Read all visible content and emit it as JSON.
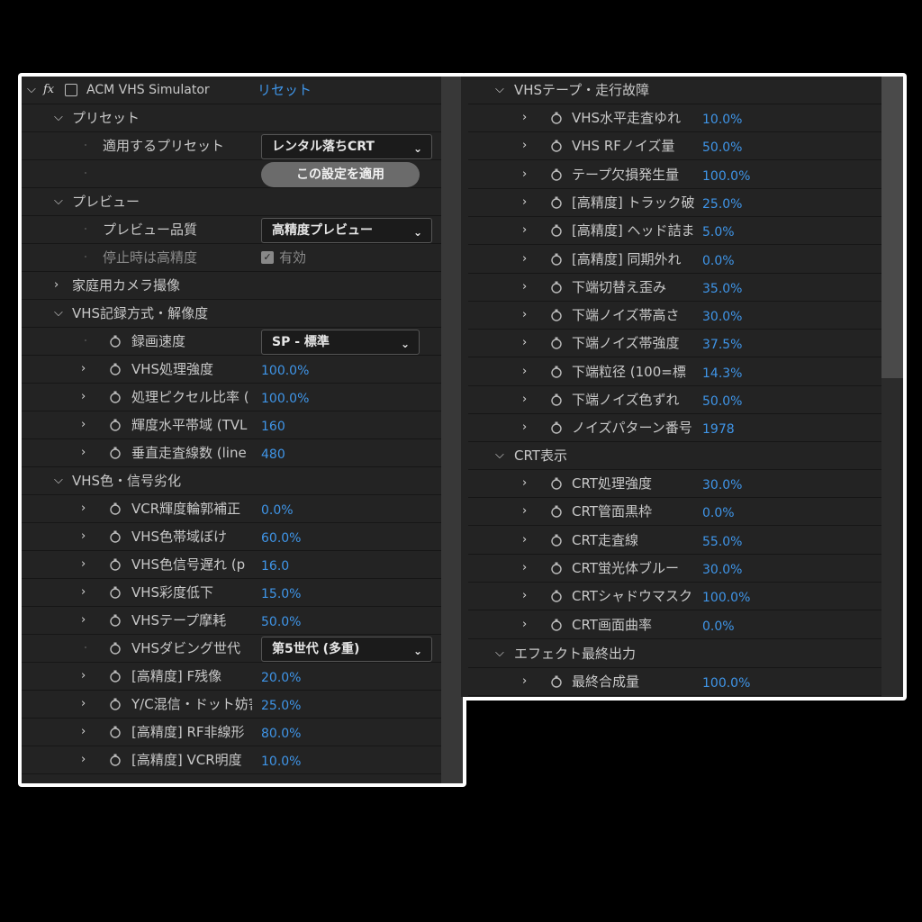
{
  "effect": {
    "title": "ACM VHS Simulator",
    "reset_label": "リセット",
    "fx_label": "fx"
  },
  "left": {
    "preset_group": "プリセット",
    "preset_label": "適用するプリセット",
    "preset_value": "レンタル落ちCRT",
    "apply_label": "この設定を適用",
    "preview_group": "プレビュー",
    "preview_quality_label": "プレビュー品質",
    "preview_quality_value": "高精度プレビュー",
    "still_hq_label": "停止時は高精度",
    "still_hq_checkbox": "有効",
    "home_camera_group": "家庭用カメラ撮像",
    "rec_group": "VHS記録方式・解像度",
    "rec_speed_label": "録画速度",
    "rec_speed_value": "SP - 標準",
    "rec_params": [
      {
        "label": "VHS処理強度",
        "value": "100.0%"
      },
      {
        "label": "処理ピクセル比率 (",
        "value": "100.0%"
      },
      {
        "label": "輝度水平帯域 (TVL",
        "value": "160"
      },
      {
        "label": "垂直走査線数 (line",
        "value": "480"
      }
    ],
    "color_group": "VHS色・信号劣化",
    "color_params_a": [
      {
        "label": "VCR輝度輪郭補正",
        "value": "0.0%"
      },
      {
        "label": "VHS色帯域ぼけ",
        "value": "60.0%"
      },
      {
        "label": "VHS色信号遅れ (p",
        "value": "16.0"
      },
      {
        "label": "VHS彩度低下",
        "value": "15.0%"
      },
      {
        "label": "VHSテープ摩耗",
        "value": "50.0%"
      }
    ],
    "dubbing_label": "VHSダビング世代",
    "dubbing_value": "第5世代 (多重)",
    "color_params_b": [
      {
        "label": "[高精度] F残像",
        "value": "20.0%"
      },
      {
        "label": "Y/C混信・ドット妨害",
        "value": "25.0%"
      },
      {
        "label": "[高精度] RF非線形",
        "value": "80.0%"
      },
      {
        "label": "[高精度] VCR明度",
        "value": "10.0%"
      }
    ]
  },
  "right": {
    "tape_group": "VHSテープ・走行故障",
    "tape_params": [
      {
        "label": "VHS水平走査ゆれ",
        "value": "10.0%"
      },
      {
        "label": "VHS RFノイズ量",
        "value": "50.0%"
      },
      {
        "label": "テープ欠損発生量",
        "value": "100.0%"
      },
      {
        "label": "[高精度] トラック破",
        "value": "25.0%"
      },
      {
        "label": "[高精度] ヘッド詰ま",
        "value": "5.0%"
      },
      {
        "label": "[高精度] 同期外れ",
        "value": "0.0%"
      },
      {
        "label": "下端切替え歪み",
        "value": "35.0%"
      },
      {
        "label": "下端ノイズ帯高さ",
        "value": "30.0%"
      },
      {
        "label": "下端ノイズ帯強度",
        "value": "37.5%"
      },
      {
        "label": "下端粒径 (100=標",
        "value": "14.3%"
      },
      {
        "label": "下端ノイズ色ずれ",
        "value": "50.0%"
      },
      {
        "label": "ノイズパターン番号",
        "value": "1978"
      }
    ],
    "crt_group": "CRT表示",
    "crt_params": [
      {
        "label": "CRT処理強度",
        "value": "30.0%"
      },
      {
        "label": "CRT管面黒枠",
        "value": "0.0%"
      },
      {
        "label": "CRT走査線",
        "value": "55.0%"
      },
      {
        "label": "CRT蛍光体ブルー",
        "value": "30.0%"
      },
      {
        "label": "CRTシャドウマスク",
        "value": "100.0%"
      },
      {
        "label": "CRT画面曲率",
        "value": "0.0%"
      }
    ],
    "output_group": "エフェクト最終出力",
    "output_params": [
      {
        "label": "最終合成量",
        "value": "100.0%"
      }
    ]
  },
  "colors": {
    "panel_bg": "#232323",
    "value_blue": "#3f95e8",
    "frame_white": "#ffffff"
  }
}
